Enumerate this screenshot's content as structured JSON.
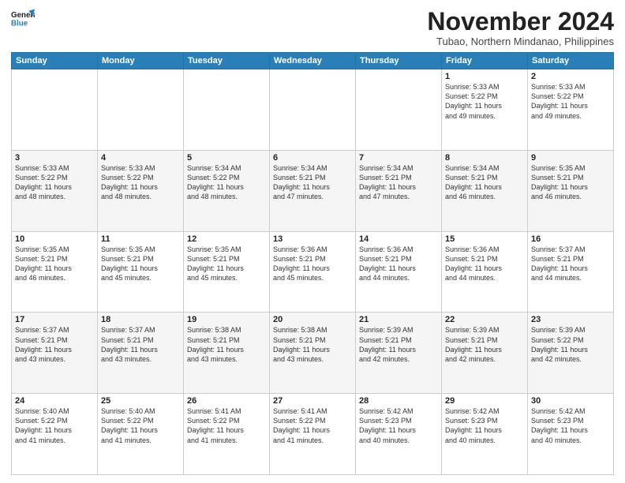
{
  "logo": {
    "line1": "General",
    "line2": "Blue"
  },
  "header": {
    "month": "November 2024",
    "location": "Tubao, Northern Mindanao, Philippines"
  },
  "weekdays": [
    "Sunday",
    "Monday",
    "Tuesday",
    "Wednesday",
    "Thursday",
    "Friday",
    "Saturday"
  ],
  "weeks": [
    [
      {
        "day": "",
        "info": ""
      },
      {
        "day": "",
        "info": ""
      },
      {
        "day": "",
        "info": ""
      },
      {
        "day": "",
        "info": ""
      },
      {
        "day": "",
        "info": ""
      },
      {
        "day": "1",
        "info": "Sunrise: 5:33 AM\nSunset: 5:22 PM\nDaylight: 11 hours\nand 49 minutes."
      },
      {
        "day": "2",
        "info": "Sunrise: 5:33 AM\nSunset: 5:22 PM\nDaylight: 11 hours\nand 49 minutes."
      }
    ],
    [
      {
        "day": "3",
        "info": "Sunrise: 5:33 AM\nSunset: 5:22 PM\nDaylight: 11 hours\nand 48 minutes."
      },
      {
        "day": "4",
        "info": "Sunrise: 5:33 AM\nSunset: 5:22 PM\nDaylight: 11 hours\nand 48 minutes."
      },
      {
        "day": "5",
        "info": "Sunrise: 5:34 AM\nSunset: 5:22 PM\nDaylight: 11 hours\nand 48 minutes."
      },
      {
        "day": "6",
        "info": "Sunrise: 5:34 AM\nSunset: 5:21 PM\nDaylight: 11 hours\nand 47 minutes."
      },
      {
        "day": "7",
        "info": "Sunrise: 5:34 AM\nSunset: 5:21 PM\nDaylight: 11 hours\nand 47 minutes."
      },
      {
        "day": "8",
        "info": "Sunrise: 5:34 AM\nSunset: 5:21 PM\nDaylight: 11 hours\nand 46 minutes."
      },
      {
        "day": "9",
        "info": "Sunrise: 5:35 AM\nSunset: 5:21 PM\nDaylight: 11 hours\nand 46 minutes."
      }
    ],
    [
      {
        "day": "10",
        "info": "Sunrise: 5:35 AM\nSunset: 5:21 PM\nDaylight: 11 hours\nand 46 minutes."
      },
      {
        "day": "11",
        "info": "Sunrise: 5:35 AM\nSunset: 5:21 PM\nDaylight: 11 hours\nand 45 minutes."
      },
      {
        "day": "12",
        "info": "Sunrise: 5:35 AM\nSunset: 5:21 PM\nDaylight: 11 hours\nand 45 minutes."
      },
      {
        "day": "13",
        "info": "Sunrise: 5:36 AM\nSunset: 5:21 PM\nDaylight: 11 hours\nand 45 minutes."
      },
      {
        "day": "14",
        "info": "Sunrise: 5:36 AM\nSunset: 5:21 PM\nDaylight: 11 hours\nand 44 minutes."
      },
      {
        "day": "15",
        "info": "Sunrise: 5:36 AM\nSunset: 5:21 PM\nDaylight: 11 hours\nand 44 minutes."
      },
      {
        "day": "16",
        "info": "Sunrise: 5:37 AM\nSunset: 5:21 PM\nDaylight: 11 hours\nand 44 minutes."
      }
    ],
    [
      {
        "day": "17",
        "info": "Sunrise: 5:37 AM\nSunset: 5:21 PM\nDaylight: 11 hours\nand 43 minutes."
      },
      {
        "day": "18",
        "info": "Sunrise: 5:37 AM\nSunset: 5:21 PM\nDaylight: 11 hours\nand 43 minutes."
      },
      {
        "day": "19",
        "info": "Sunrise: 5:38 AM\nSunset: 5:21 PM\nDaylight: 11 hours\nand 43 minutes."
      },
      {
        "day": "20",
        "info": "Sunrise: 5:38 AM\nSunset: 5:21 PM\nDaylight: 11 hours\nand 43 minutes."
      },
      {
        "day": "21",
        "info": "Sunrise: 5:39 AM\nSunset: 5:21 PM\nDaylight: 11 hours\nand 42 minutes."
      },
      {
        "day": "22",
        "info": "Sunrise: 5:39 AM\nSunset: 5:21 PM\nDaylight: 11 hours\nand 42 minutes."
      },
      {
        "day": "23",
        "info": "Sunrise: 5:39 AM\nSunset: 5:22 PM\nDaylight: 11 hours\nand 42 minutes."
      }
    ],
    [
      {
        "day": "24",
        "info": "Sunrise: 5:40 AM\nSunset: 5:22 PM\nDaylight: 11 hours\nand 41 minutes."
      },
      {
        "day": "25",
        "info": "Sunrise: 5:40 AM\nSunset: 5:22 PM\nDaylight: 11 hours\nand 41 minutes."
      },
      {
        "day": "26",
        "info": "Sunrise: 5:41 AM\nSunset: 5:22 PM\nDaylight: 11 hours\nand 41 minutes."
      },
      {
        "day": "27",
        "info": "Sunrise: 5:41 AM\nSunset: 5:22 PM\nDaylight: 11 hours\nand 41 minutes."
      },
      {
        "day": "28",
        "info": "Sunrise: 5:42 AM\nSunset: 5:23 PM\nDaylight: 11 hours\nand 40 minutes."
      },
      {
        "day": "29",
        "info": "Sunrise: 5:42 AM\nSunset: 5:23 PM\nDaylight: 11 hours\nand 40 minutes."
      },
      {
        "day": "30",
        "info": "Sunrise: 5:42 AM\nSunset: 5:23 PM\nDaylight: 11 hours\nand 40 minutes."
      }
    ]
  ]
}
